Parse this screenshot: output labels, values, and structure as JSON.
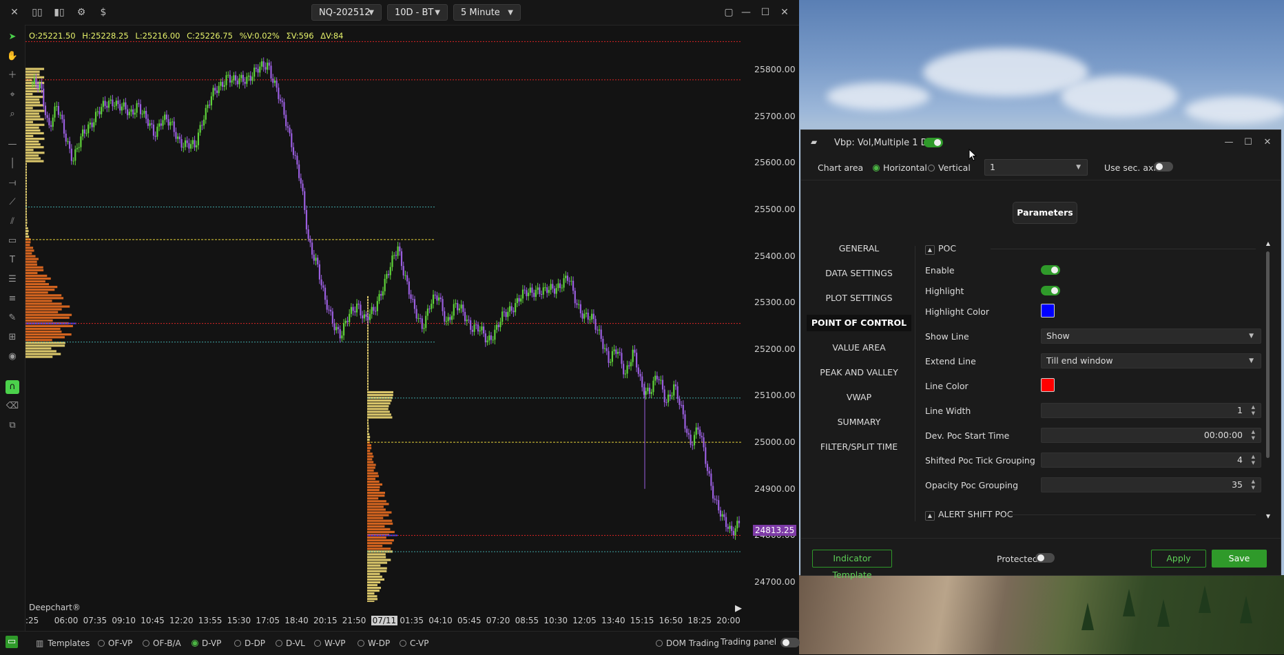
{
  "toolbar": {
    "symbol": "NQ-202512",
    "range": "10D - BT",
    "timeframe": "5 Minute",
    "icons": [
      "close-icon",
      "candles-icon",
      "bar-chart-icon",
      "gear-icon",
      "dollar-icon"
    ]
  },
  "ohlc": {
    "open": "O:25221.50",
    "high": "H:25228.25",
    "low": "L:25216.00",
    "close": "C:25226.75",
    "pct": "%V:0.02%",
    "sumv": "ΣV:596",
    "dv": "ΔV:84"
  },
  "price_axis": {
    "ticks": [
      "25800.00",
      "25700.00",
      "25600.00",
      "25500.00",
      "25400.00",
      "25300.00",
      "25200.00",
      "25100.00",
      "25000.00",
      "24900.00",
      "24800.00",
      "24700.00"
    ],
    "last_price": "24813.25"
  },
  "time_axis": {
    "ticks": [
      ":25",
      "06:00",
      "07:35",
      "09:10",
      "10:45",
      "12:20",
      "13:55",
      "15:30",
      "17:05",
      "18:40",
      "20:15",
      "21:50",
      "07/11",
      "01:35",
      "04:10",
      "05:45",
      "07:20",
      "08:55",
      "10:30",
      "12:05",
      "13:40",
      "15:15",
      "16:50",
      "18:25",
      "20:00"
    ]
  },
  "chart_data": {
    "type": "line",
    "title": "",
    "ylim": [
      24640,
      25875
    ],
    "series": [
      {
        "values": [
          25770,
          25760,
          25680,
          25720,
          25660,
          25610,
          25650,
          25680,
          25710,
          25720,
          25735,
          25720,
          25700,
          25730,
          25690,
          25660,
          25700,
          25680,
          25650,
          25640,
          25630,
          25700,
          25740,
          25760,
          25790,
          25770,
          25780,
          25790,
          25800,
          25815,
          25760,
          25700,
          25640,
          25560,
          25430,
          25390,
          25300,
          25260,
          25230,
          25270,
          25300,
          25260,
          25280,
          25330,
          25370,
          25420,
          25350,
          25280,
          25250,
          25300,
          25310,
          25260,
          25290,
          25280,
          25250,
          25240,
          25220,
          25240,
          25270,
          25290,
          25310,
          25320,
          25330,
          25320,
          25330,
          25340,
          25350,
          25300,
          25270,
          25260,
          25230,
          25170,
          25200,
          25150,
          25190,
          25120,
          25110,
          25140,
          25090,
          25120,
          25060,
          25000,
          25030,
          24950,
          24880,
          24830,
          24810,
          24830
        ]
      }
    ],
    "volume_profiles": [
      {
        "session": 1,
        "poc": 25255,
        "vah": 25435,
        "val": 25215
      },
      {
        "session": 2,
        "poc": 24800,
        "vah": 25000,
        "val": 24765
      }
    ]
  },
  "watermark": "Deepchart®",
  "bottom_bar": {
    "templates_label": "Templates",
    "templates": [
      {
        "label": "OF-VP",
        "selected": false
      },
      {
        "label": "OF-B/A",
        "selected": false
      },
      {
        "label": "D-VP",
        "selected": true
      },
      {
        "label": "D-DP",
        "selected": false
      },
      {
        "label": "D-VL",
        "selected": false
      },
      {
        "label": "W-VP",
        "selected": false
      },
      {
        "label": "W-DP",
        "selected": false
      },
      {
        "label": "C-VP",
        "selected": false
      }
    ],
    "dom_trading": "DOM Trading",
    "trading_panel": "Trading panel"
  },
  "dialog": {
    "title": "Vbp: Vol,Multiple 1 D",
    "chart_area_label": "Chart area",
    "horizontal": "Horizontal",
    "vertical": "Vertical",
    "area_value": "1",
    "use_sec_axis": "Use sec. axis",
    "parameters_tab": "Parameters",
    "nav": [
      "GENERAL",
      "DATA SETTINGS",
      "PLOT SETTINGS",
      "POINT OF CONTROL",
      "VALUE AREA",
      "PEAK AND VALLEY",
      "VWAP",
      "SUMMARY",
      "FILTER/SPLIT TIME"
    ],
    "active_nav": "POINT OF CONTROL",
    "section": "POC",
    "props": {
      "enable": "Enable",
      "highlight": "Highlight",
      "highlight_color": "Highlight Color",
      "show_line": "Show Line",
      "show_line_value": "Show",
      "extend_line": "Extend Line",
      "extend_line_value": "Till end window",
      "line_color": "Line Color",
      "line_width": "Line Width",
      "line_width_value": "1",
      "dev_poc_start": "Dev. Poc Start Time",
      "dev_poc_start_value": "00:00:00",
      "shifted_poc": "Shifted Poc Tick Grouping",
      "shifted_poc_value": "4",
      "opacity_poc": "Opacity Poc Grouping",
      "opacity_poc_value": "35"
    },
    "next_section": "ALERT SHIFT POC",
    "colors": {
      "highlight": "#0000ff",
      "line": "#ff0000"
    },
    "footer": {
      "indicator_template": "Indicator Template",
      "protected": "Protected",
      "apply": "Apply",
      "save": "Save"
    }
  }
}
